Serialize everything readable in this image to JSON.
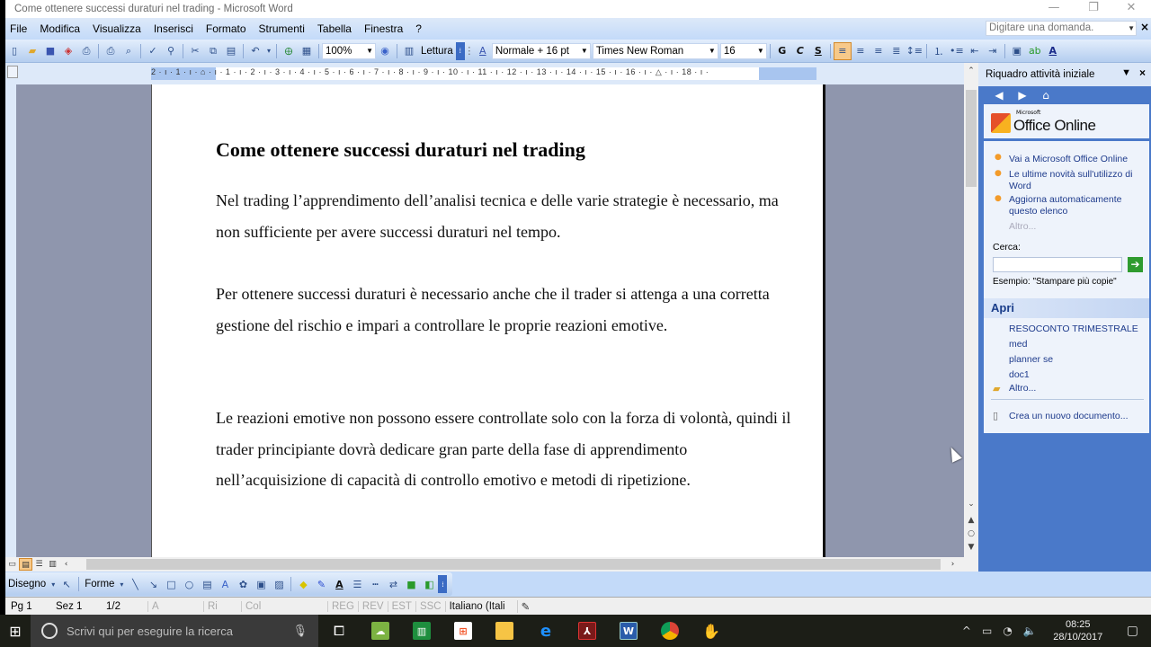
{
  "window": {
    "title": "Come ottenere successi duraturi nel trading - Microsoft Word",
    "controls": {
      "minimize": "—",
      "restore": "❐",
      "close": "✕"
    }
  },
  "menu": {
    "items": [
      "File",
      "Modifica",
      "Visualizza",
      "Inserisci",
      "Formato",
      "Strumenti",
      "Tabella",
      "Finestra",
      "?"
    ],
    "ask_placeholder": "Digitare una domanda."
  },
  "toolbar": {
    "zoom": "100%",
    "reading_label": "Lettura",
    "style": "Normale + 16 pt",
    "font": "Times New Roman",
    "size": "16",
    "bold": "G",
    "italic": "C",
    "underline": "S"
  },
  "ruler": {
    "labels": "2 · ı · 1 · ı · ⌂ · ı · 1 · ı · 2 · ı · 3 · ı · 4 · ı · 5 · ı · 6 · ı · 7 · ı · 8 · ı · 9 · ı · 10 · ı · 11 · ı · 12 · ı · 13 · ı · 14 · ı · 15 · ı · 16 · ı · △ · ı · 18 · ı ·"
  },
  "document": {
    "title": "Come ottenere successi duraturi nel trading",
    "paragraphs": [
      "Nel trading l’apprendimento dell’analisi tecnica e delle varie strategie è necessario, ma non sufficiente per avere successi duraturi nel tempo.",
      "Per ottenere successi duraturi è necessario anche che il trader si attenga a una corretta gestione del rischio e impari a controllare le proprie reazioni emotive.",
      "Le reazioni emotive non possono essere controllate solo con la forza di volontà, quindi il trader principiante dovrà dedicare gran parte della fase di apprendimento nell’acquisizione di capacità di controllo emotivo e metodi di ripetizione."
    ]
  },
  "task_pane": {
    "title": "Riquadro attività iniziale",
    "logo_small": "Microsoft",
    "logo": "Office Online",
    "links": [
      "Vai a Microsoft Office Online",
      "Le ultime novità sull'utilizzo di Word",
      "Aggiorna automaticamente questo elenco"
    ],
    "more": "Altro...",
    "search_label": "Cerca:",
    "search_value": "",
    "example": "Esempio:  \"Stampare più copie\"",
    "open_header": "Apri",
    "recent": [
      "RESOCONTO TRIMESTRALE",
      "med",
      "planner se",
      "doc1"
    ],
    "open_more": "Altro...",
    "new_doc": "Crea un nuovo documento..."
  },
  "drawing_bar": {
    "draw_label": "Disegno",
    "shapes_label": "Forme"
  },
  "status": {
    "page": "Pg 1",
    "section": "Sez 1",
    "pages": "1/2",
    "at": "A",
    "line": "Ri",
    "col": "Col",
    "rec": "REG",
    "rev": "REV",
    "ext": "EST",
    "ovr": "SSC",
    "language": "Italiano (Itali"
  },
  "taskbar": {
    "search_placeholder": "Scrivi qui per eseguire la ricerca",
    "time": "08:25",
    "date": "28/10/2017"
  }
}
